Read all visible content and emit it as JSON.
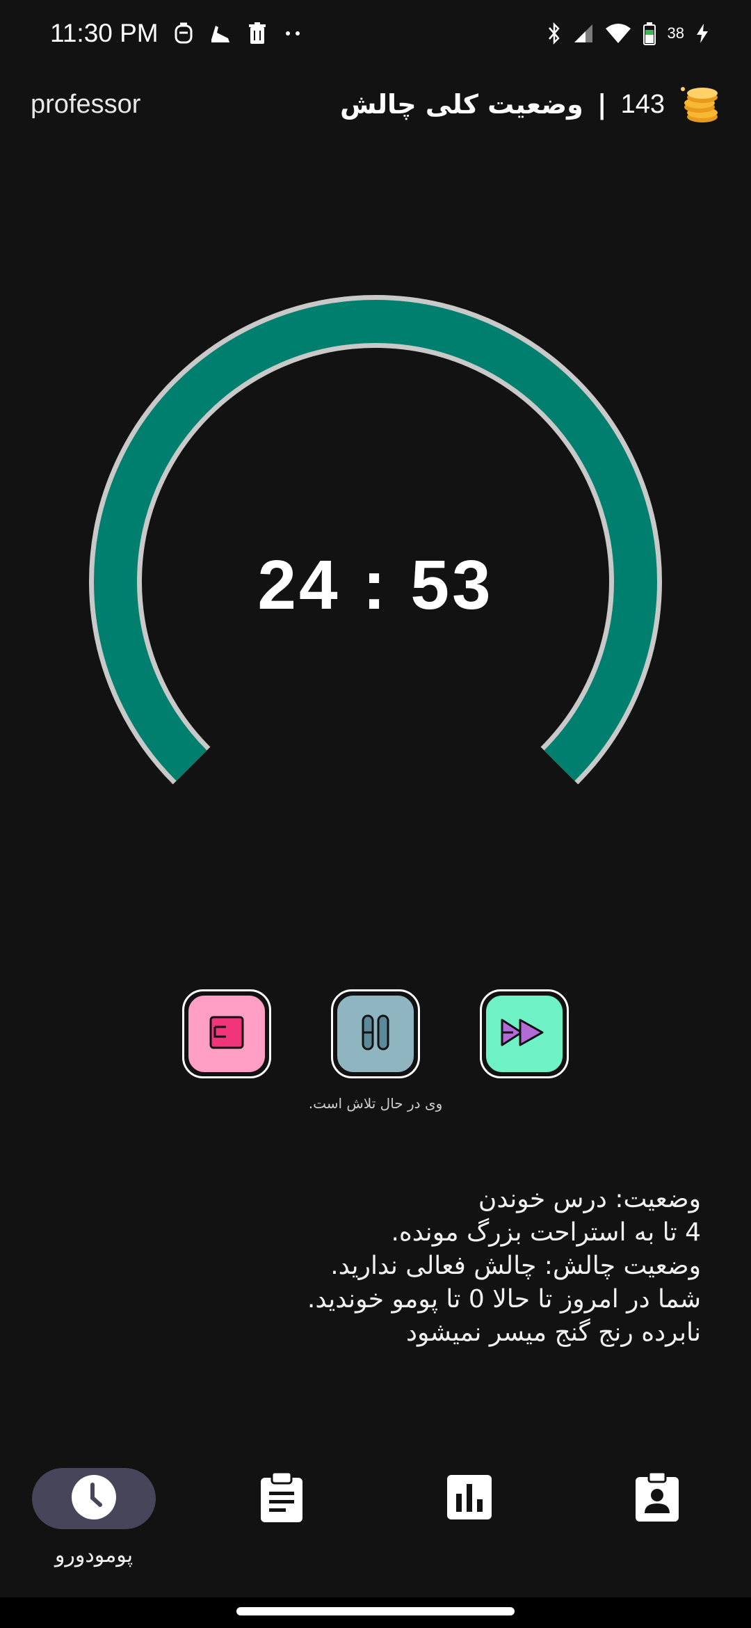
{
  "status_bar": {
    "time": "11:30 PM",
    "battery": "38",
    "icons": [
      "app-notification-icon",
      "shoe-icon",
      "trash-icon",
      "more-dots-icon",
      "bluetooth-icon",
      "signal-icon",
      "wifi-icon",
      "battery-icon",
      "charging-icon"
    ]
  },
  "header": {
    "username": "professor",
    "title": "وضعیت کلی چالش",
    "separator": "|",
    "coins": "143",
    "coin_icon": "coins-icon"
  },
  "timer": {
    "display": "24 : 53",
    "progress_fraction": 1.0,
    "arc_color": "#007f6e",
    "track_color": "#c9c9c9"
  },
  "controls": [
    {
      "name": "exit-button",
      "icon": "exit-icon",
      "color": "#ff9fc4"
    },
    {
      "name": "pause-button",
      "icon": "pause-icon",
      "color": "#8fb5c1"
    },
    {
      "name": "skip-button",
      "icon": "fast-forward-icon",
      "color": "#6ff2c6"
    }
  ],
  "trying_text": "وی در حال تلاش است.",
  "status_lines": [
    "وضعیت: درس خوندن",
    "4 تا به استراحت بزرگ مونده.",
    "وضعیت چالش: چالش فعالی ندارید.",
    "شما در امروز تا حالا 0 تا پومو خوندید.",
    "نابرده رنج گنج میسر نمیشود"
  ],
  "bottom_nav": {
    "items": [
      {
        "name": "nav-pomodoro",
        "icon": "clock-icon",
        "label": "پومودورو",
        "active": true
      },
      {
        "name": "nav-tasks",
        "icon": "clipboard-icon",
        "label": "",
        "active": false
      },
      {
        "name": "nav-stats",
        "icon": "bar-chart-icon",
        "label": "",
        "active": false
      },
      {
        "name": "nav-profile",
        "icon": "profile-badge-icon",
        "label": "",
        "active": false
      }
    ]
  }
}
